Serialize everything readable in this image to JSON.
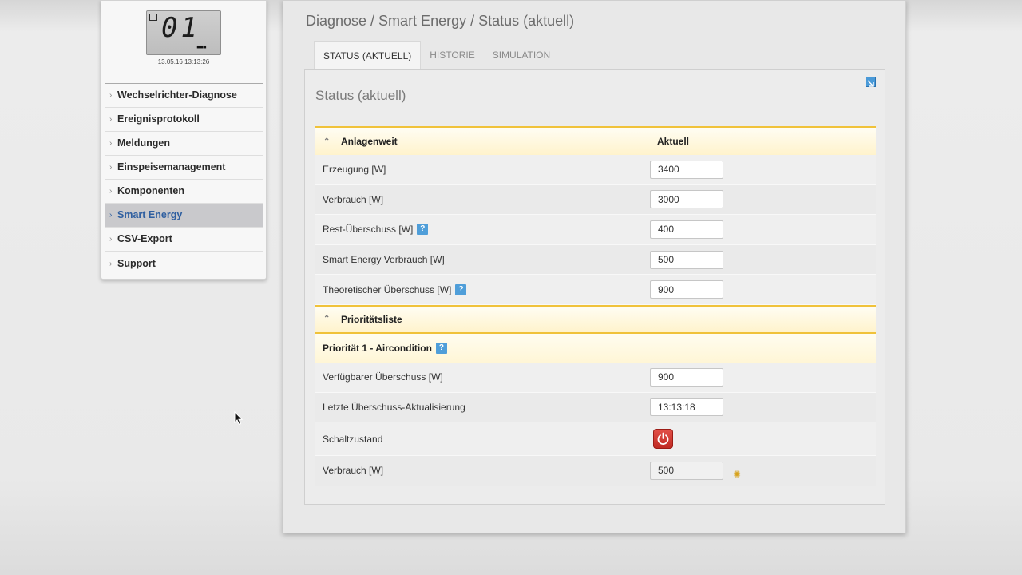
{
  "sidebar": {
    "display_digits": "01",
    "display_date": "13.05.16 13:13:26",
    "items": [
      {
        "label": "Wechselrichter-Diagnose"
      },
      {
        "label": "Ereignisprotokoll"
      },
      {
        "label": "Meldungen"
      },
      {
        "label": "Einspeisemanagement"
      },
      {
        "label": "Komponenten"
      },
      {
        "label": "Smart Energy"
      },
      {
        "label": "CSV-Export"
      },
      {
        "label": "Support"
      }
    ],
    "active_item": "Smart Energy"
  },
  "main": {
    "breadcrumb": "Diagnose / Smart Energy / Status (aktuell)",
    "tabs": [
      {
        "label": "STATUS (AKTUELL)"
      },
      {
        "label": "HISTORIE"
      },
      {
        "label": "SIMULATION"
      }
    ],
    "active_tab": "STATUS (AKTUELL)",
    "section_title": "Status (aktuell)",
    "group1": {
      "label": "Anlagenweit",
      "column_header": "Aktuell",
      "rows": [
        {
          "label": "Erzeugung [W]",
          "value": "3400"
        },
        {
          "label": "Verbrauch [W]",
          "value": "3000"
        },
        {
          "label": "Rest-Überschuss [W]",
          "value": "400"
        },
        {
          "label": "Smart Energy Verbrauch [W]",
          "value": "500"
        },
        {
          "label": "Theoretischer Überschuss [W]",
          "value": "900"
        }
      ]
    },
    "group2": {
      "label": "Prioritätsliste",
      "priority_title": "Priorität 1 - Aircondition",
      "rows": [
        {
          "label": "Verfügbarer Überschuss [W]",
          "value": "900"
        },
        {
          "label": "Letzte Überschuss-Aktualisierung",
          "value": "13:13:18"
        },
        {
          "label": "Schaltzustand"
        },
        {
          "label": "Verbrauch [W]",
          "value": "500"
        }
      ]
    },
    "help_glyph": "?",
    "accent_color": "#f0c23a",
    "power_color": "#c9302c"
  }
}
